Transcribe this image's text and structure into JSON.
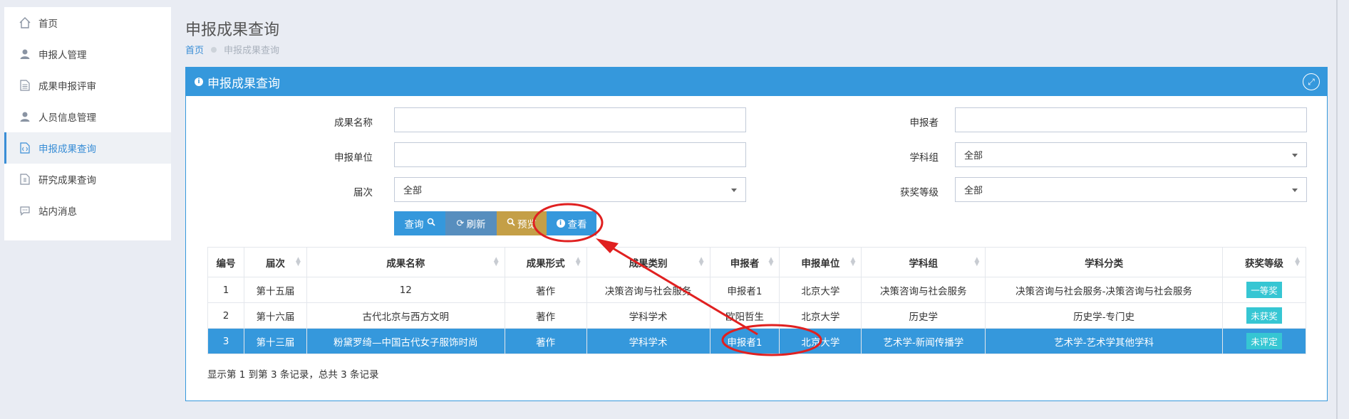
{
  "sidebar": {
    "items": [
      {
        "label": "首页",
        "icon": "home-icon"
      },
      {
        "label": "申报人管理",
        "icon": "user-icon"
      },
      {
        "label": "成果申报评审",
        "icon": "document-icon"
      },
      {
        "label": "人员信息管理",
        "icon": "user-icon"
      },
      {
        "label": "申报成果查询",
        "icon": "code-file-icon",
        "active": true
      },
      {
        "label": "研究成果查询",
        "icon": "file-icon"
      },
      {
        "label": "站内消息",
        "icon": "chat-icon"
      }
    ]
  },
  "header": {
    "title": "申报成果查询",
    "breadcrumb_home": "首页",
    "breadcrumb_current": "申报成果查询"
  },
  "panel": {
    "title": "申报成果查询"
  },
  "filters": {
    "name_label": "成果名称",
    "name_value": "",
    "reporter_label": "申报者",
    "reporter_value": "",
    "unit_label": "申报单位",
    "unit_value": "",
    "subject_group_label": "学科组",
    "subject_group_value": "全部",
    "session_label": "届次",
    "session_value": "全部",
    "award_label": "获奖等级",
    "award_value": "全部"
  },
  "buttons": {
    "query": "查询",
    "refresh": "刷新",
    "preview": "预览",
    "view": "查看"
  },
  "table": {
    "headers": [
      "编号",
      "届次",
      "成果名称",
      "成果形式",
      "成果类别",
      "申报者",
      "申报单位",
      "学科组",
      "学科分类",
      "获奖等级"
    ],
    "rows": [
      [
        "1",
        "第十五届",
        "12",
        "著作",
        "决策咨询与社会服务",
        "申报者1",
        "北京大学",
        "决策咨询与社会服务",
        "决策咨询与社会服务-决策咨询与社会服务",
        "一等奖"
      ],
      [
        "2",
        "第十六届",
        "古代北京与西方文明",
        "著作",
        "学科学术",
        "欧阳哲生",
        "北京大学",
        "历史学",
        "历史学-专门史",
        "未获奖"
      ],
      [
        "3",
        "第十三届",
        "粉黛罗绮—中国古代女子服饰时尚",
        "著作",
        "学科学术",
        "申报者1",
        "北京大学",
        "艺术学-新闻传播学",
        "艺术学-艺术学其他学科",
        "未评定"
      ]
    ],
    "selected_row": 3
  },
  "footer": {
    "summary": "显示第 1 到第 3 条记录，总共 3 条记录"
  },
  "colors": {
    "primary": "#3598dc",
    "annotation": "#e02020"
  }
}
